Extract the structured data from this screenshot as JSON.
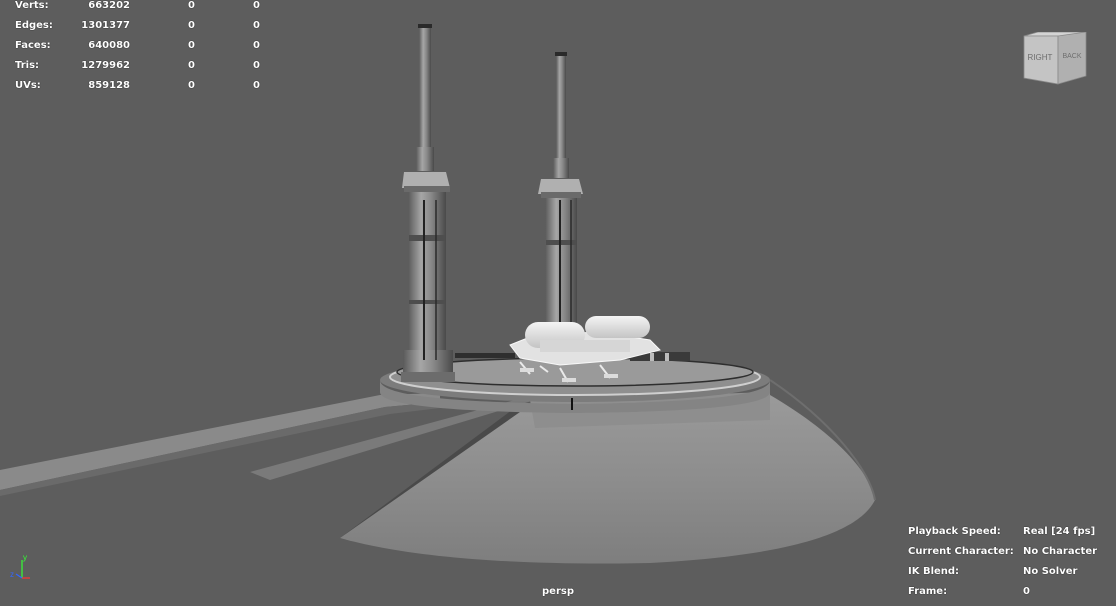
{
  "viewport": {
    "camera": "persp",
    "background": "#5d5d5d"
  },
  "stats": [
    {
      "label": "Verts:",
      "total": "663202",
      "selected": "0",
      "component": "0"
    },
    {
      "label": "Edges:",
      "total": "1301377",
      "selected": "0",
      "component": "0"
    },
    {
      "label": "Faces:",
      "total": "640080",
      "selected": "0",
      "component": "0"
    },
    {
      "label": "Tris:",
      "total": "1279962",
      "selected": "0",
      "component": "0"
    },
    {
      "label": "UVs:",
      "total": "859128",
      "selected": "0",
      "component": "0"
    }
  ],
  "hud_right": [
    {
      "label": "Playback Speed:",
      "value": "Real [24 fps]"
    },
    {
      "label": "Current Character:",
      "value": "No Character"
    },
    {
      "label": "IK Blend:",
      "value": "No Solver"
    },
    {
      "label": "Frame:",
      "value": "0"
    }
  ],
  "viewcube": {
    "left_face": "RIGHT",
    "right_face": "BACK"
  },
  "axis": {
    "y": "y",
    "z": "z",
    "x": "x",
    "y_color": "#33ff33",
    "z_color": "#3366ff",
    "x_color": "#ff3333"
  }
}
